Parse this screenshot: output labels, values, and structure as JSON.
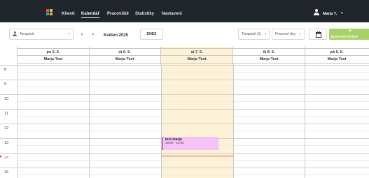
{
  "nav": {
    "items": [
      "Klienti",
      "Kalendář",
      "Pracoviště",
      "Statistiky",
      "Nastavení"
    ],
    "active_index": 1,
    "user_name": "Marja T.",
    "user_caret": "▾"
  },
  "colors": {
    "nav_bg": "#20262b",
    "accent_green": "#a7d26a",
    "today_bg": "#fdf2d6",
    "event_bg": "#f5c2f5",
    "now_line": "#e05050"
  },
  "toolbar": {
    "therapist_select": "Terapeuti",
    "prev": "‹",
    "next": "›",
    "month": "Květen 2025",
    "today_label": "DNES",
    "filter_therapists": "Terapeuti (1)",
    "filter_days": "Pracovní dny",
    "calendar_icon": "calendar-icon",
    "new_plus": "+",
    "new_label": "NOVÁ NÁVŠTĚVA"
  },
  "calendar": {
    "days": [
      {
        "date": "po 5. 5.",
        "therapist": "Marja Test"
      },
      {
        "date": "út 6. 5.",
        "therapist": "Marja Test"
      },
      {
        "date": "st 7. 5.",
        "therapist": "Marja Test"
      },
      {
        "date": "čt 8. 5.",
        "therapist": "Marja Test"
      },
      {
        "date": "pá 9. 5.",
        "therapist": "Marja Test"
      }
    ],
    "today_index": 2,
    "hours": [
      "8",
      "9",
      "10",
      "11",
      "12",
      "13",
      "14",
      "15"
    ],
    "current_hour_index": 6,
    "event": {
      "title": "test marja",
      "time": "13:00 - 14:00"
    }
  }
}
